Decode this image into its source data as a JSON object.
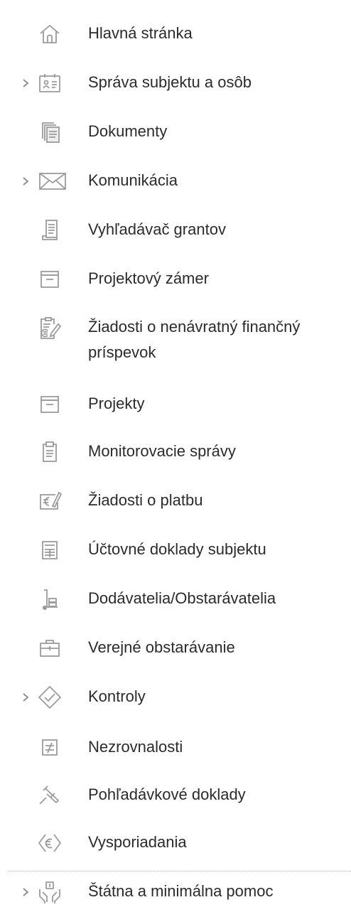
{
  "sidebar": {
    "items": [
      {
        "label": "Hlavná stránka",
        "icon": "home-icon",
        "expandable": false
      },
      {
        "label": "Správa subjektu a osôb",
        "icon": "id-card-icon",
        "expandable": true
      },
      {
        "label": "Dokumenty",
        "icon": "documents-icon",
        "expandable": false
      },
      {
        "label": "Komunikácia",
        "icon": "envelope-icon",
        "expandable": true
      },
      {
        "label": "Vyhľadávač grantov",
        "icon": "grant-search-icon",
        "expandable": false
      },
      {
        "label": "Projektový zámer",
        "icon": "archive-box-icon",
        "expandable": false
      },
      {
        "label": "Žiadosti o nenávratný finančný príspevok",
        "icon": "euro-document-pen-icon",
        "expandable": false
      },
      {
        "label": "Projekty",
        "icon": "archive-box-icon",
        "expandable": false
      },
      {
        "label": "Monitorovacie správy",
        "icon": "clipboard-icon",
        "expandable": false
      },
      {
        "label": "Žiadosti o platbu",
        "icon": "euro-card-pen-icon",
        "expandable": false
      },
      {
        "label": "Účtovné doklady subjektu",
        "icon": "ledger-icon",
        "expandable": false
      },
      {
        "label": "Dodávatelia/Obstarávatelia",
        "icon": "supplier-icon",
        "expandable": false
      },
      {
        "label": "Verejné obstarávanie",
        "icon": "briefcase-icon",
        "expandable": false
      },
      {
        "label": "Kontroly",
        "icon": "check-diamond-icon",
        "expandable": true
      },
      {
        "label": "Nezrovnalosti",
        "icon": "not-equal-icon",
        "expandable": false
      },
      {
        "label": "Pohľadávkové doklady",
        "icon": "gavel-icon",
        "expandable": false
      },
      {
        "label": "Vysporiadania",
        "icon": "euro-diamond-icon",
        "expandable": false
      },
      {
        "label": "Štátna a minimálna pomoc",
        "icon": "helping-hands-icon",
        "expandable": true
      }
    ]
  }
}
